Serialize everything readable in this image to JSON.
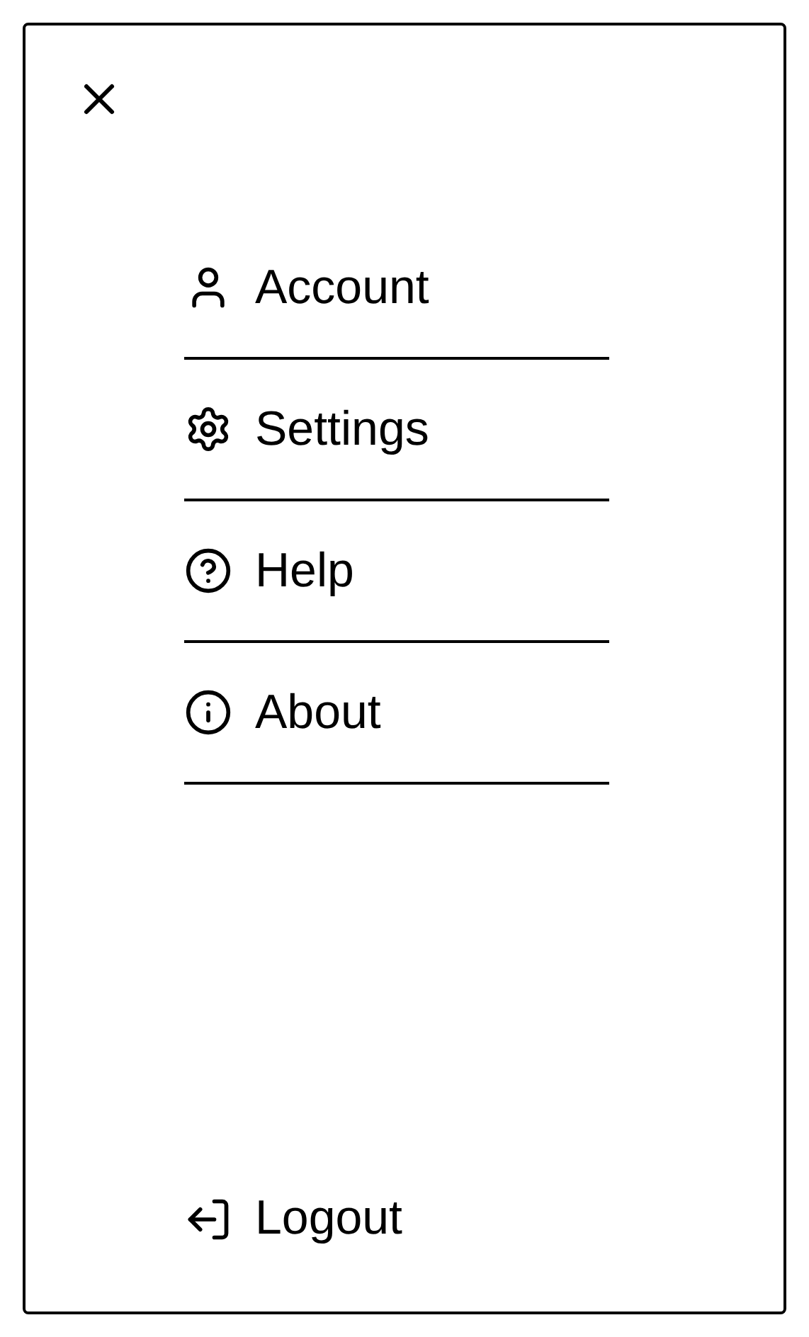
{
  "menu": {
    "items": [
      {
        "kind": "account",
        "label": "Account"
      },
      {
        "kind": "settings",
        "label": "Settings"
      },
      {
        "kind": "help",
        "label": "Help"
      },
      {
        "kind": "about",
        "label": "About"
      }
    ],
    "logout": {
      "label": "Logout"
    }
  }
}
